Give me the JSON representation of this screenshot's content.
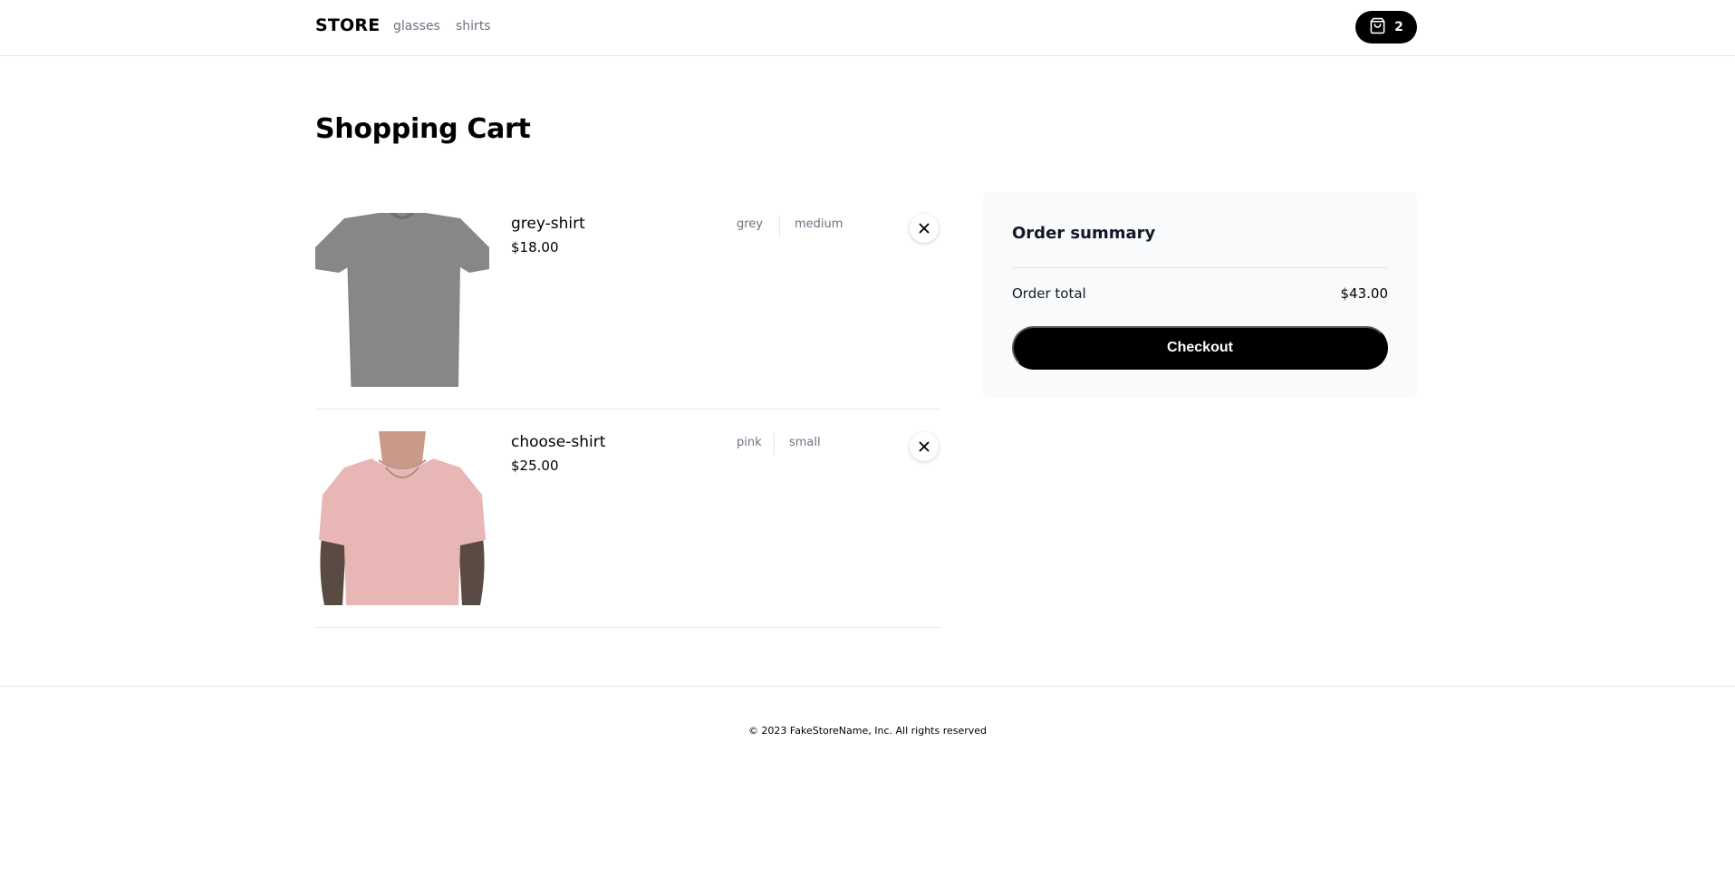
{
  "navbar": {
    "brand": "STORE",
    "links": [
      "glasses",
      "shirts"
    ],
    "cart_count": "2",
    "cart_icon": "shopping-bag-icon"
  },
  "page": {
    "title": "Shopping Cart"
  },
  "cart": {
    "items": [
      {
        "name": "grey-shirt",
        "price": "$18.00",
        "color": "grey",
        "size": "medium",
        "image": "grey t-shirt",
        "shirt_color": "#878787"
      },
      {
        "name": "choose-shirt",
        "price": "$25.00",
        "color": "pink",
        "size": "small",
        "image": "pink t-shirt on model",
        "shirt_color": "#e8b7b5"
      }
    ]
  },
  "summary": {
    "title": "Order summary",
    "total_label": "Order total",
    "total_value": "$43.00",
    "checkout_label": "Checkout"
  },
  "footer": {
    "text": "© 2023 FakeStoreName, Inc. All rights reserved"
  },
  "colors": {
    "accent": "#000000",
    "muted_text": "#6b7280",
    "border": "#e5e7eb",
    "summary_bg": "#f9fafb"
  }
}
